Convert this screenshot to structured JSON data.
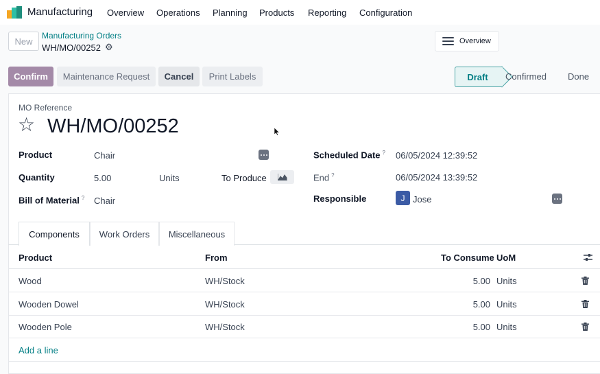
{
  "app": {
    "name": "Manufacturing",
    "menu": [
      "Overview",
      "Operations",
      "Planning",
      "Products",
      "Reporting",
      "Configuration"
    ]
  },
  "control_panel": {
    "new_label": "New",
    "breadcrumb": "Manufacturing Orders",
    "record": "WH/MO/00252",
    "overview_label": "Overview"
  },
  "actions": {
    "confirm": "Confirm",
    "maintenance": "Maintenance Request",
    "cancel": "Cancel",
    "print": "Print Labels"
  },
  "stages": [
    "Draft",
    "Confirmed",
    "Done"
  ],
  "form": {
    "ref_label": "MO Reference",
    "ref": "WH/MO/00252",
    "product_label": "Product",
    "product": "Chair",
    "quantity_label": "Quantity",
    "quantity": "5.00",
    "uom": "Units",
    "to_produce_label": "To Produce",
    "bom_label": "Bill of Material",
    "bom": "Chair",
    "scheduled_label": "Scheduled Date",
    "scheduled": "06/05/2024 12:39:52",
    "end_label": "End",
    "end": "06/05/2024 13:39:52",
    "responsible_label": "Responsible",
    "responsible_initial": "J",
    "responsible": "Jose",
    "help_mark": "?"
  },
  "tabs": [
    "Components",
    "Work Orders",
    "Miscellaneous"
  ],
  "table": {
    "headers": {
      "product": "Product",
      "from": "From",
      "to_consume": "To Consume",
      "uom": "UoM"
    },
    "rows": [
      {
        "product": "Wood",
        "from": "WH/Stock",
        "qty": "5.00",
        "uom": "Units"
      },
      {
        "product": "Wooden Dowel",
        "from": "WH/Stock",
        "qty": "5.00",
        "uom": "Units"
      },
      {
        "product": "Wooden Pole",
        "from": "WH/Stock",
        "qty": "5.00",
        "uom": "Units"
      }
    ],
    "add_line": "Add a line"
  },
  "colors": {
    "primary": "#a48aa8",
    "teal": "#017e84",
    "avatar": "#3b5ba5"
  }
}
